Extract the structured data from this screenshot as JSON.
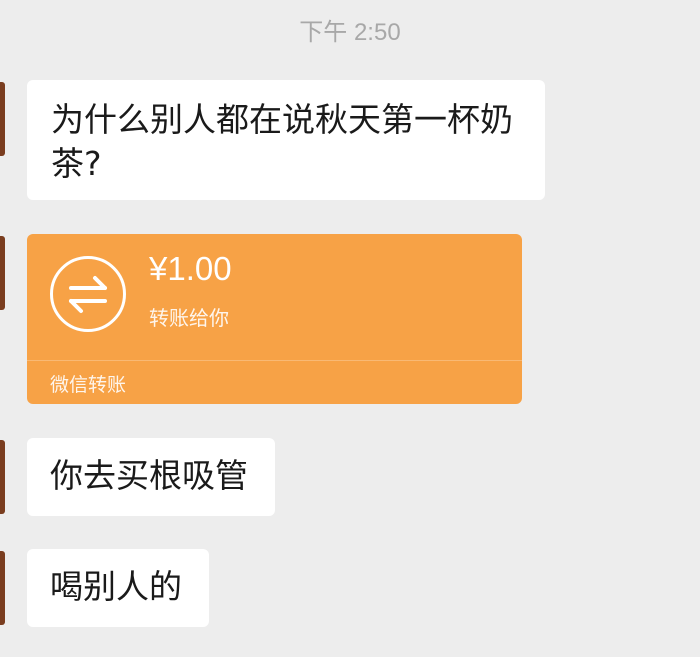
{
  "timestamp": "下午 2:50",
  "messages": [
    {
      "text": "为什么别人都在说秋天第一杯奶茶?"
    },
    {
      "text": "你去买根吸管"
    },
    {
      "text": "喝别人的"
    }
  ],
  "transfer": {
    "amount": "¥1.00",
    "caption": "转账给你",
    "footer": "微信转账",
    "icon": "transfer-arrows-icon",
    "color": "#f7a246"
  }
}
